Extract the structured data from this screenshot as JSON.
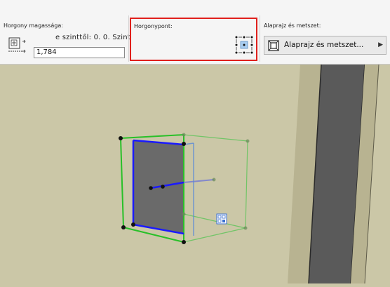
{
  "toolbar": {
    "anchor_height": {
      "title": "Horgony magassága:",
      "level_text": "e szinttől: 0. 0. Szint",
      "value": "1,784"
    },
    "anchor_point": {
      "title": "Horgonypont:"
    },
    "view": {
      "title": "Alaprajz és metszet:",
      "selected": "Alaprajz és metszet..."
    }
  },
  "colors": {
    "background": "#cbc7a7",
    "highlight_border": "#e0201c",
    "selection_green": "#28c028",
    "edge_blue": "#1a1aff",
    "wall_dark": "#5a5a5a"
  },
  "icons": [
    "anchor-height-icon",
    "anchor-point-grid-icon",
    "floor-plan-section-icon",
    "chevron-right-icon",
    "edit-handle-icon"
  ]
}
